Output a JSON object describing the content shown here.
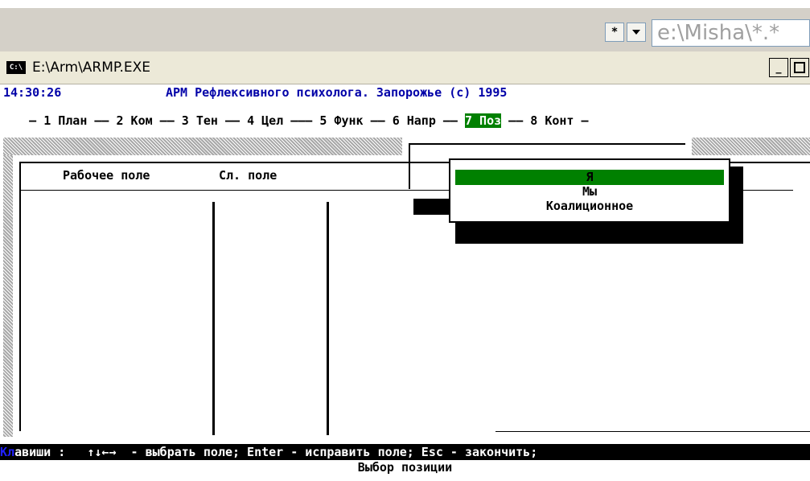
{
  "toolbar": {
    "star_button": "*",
    "dropdown_icon": "chevron-down-icon",
    "address_text": "e:\\Misha\\*.*"
  },
  "window": {
    "title": "E:\\Arm\\ARMP.EXE",
    "minimize": "_",
    "maximize": "□"
  },
  "console": {
    "time": "14:30:26",
    "app_title": "АРМ Рефлексивного психолога. Запорожье (с) 1995",
    "menu": [
      {
        "label": "1 План"
      },
      {
        "label": "2 Ком"
      },
      {
        "label": "3 Тен"
      },
      {
        "label": "4 Цел"
      },
      {
        "label": "5 Функ"
      },
      {
        "label": "6 Напр"
      },
      {
        "label": "7 Поз",
        "active": true
      },
      {
        "label": "8 Конт"
      }
    ],
    "panel": {
      "col1": "Рабочее  поле",
      "col2": "Сл. поле"
    },
    "popup": {
      "items": [
        {
          "label": "Я",
          "selected": true
        },
        {
          "label": "Мы"
        },
        {
          "label": "Коалиционное"
        }
      ]
    },
    "status": {
      "prefix": "Кл",
      "text": "авиши :   ↑↓←→  - выбрать поле; Enter - исправить поле; Esc - закончить;"
    },
    "footer": "Выбор позиции"
  },
  "colors": {
    "console_bg": "#ffffff",
    "highlight": "#008000",
    "title_blue": "#0000a8"
  }
}
